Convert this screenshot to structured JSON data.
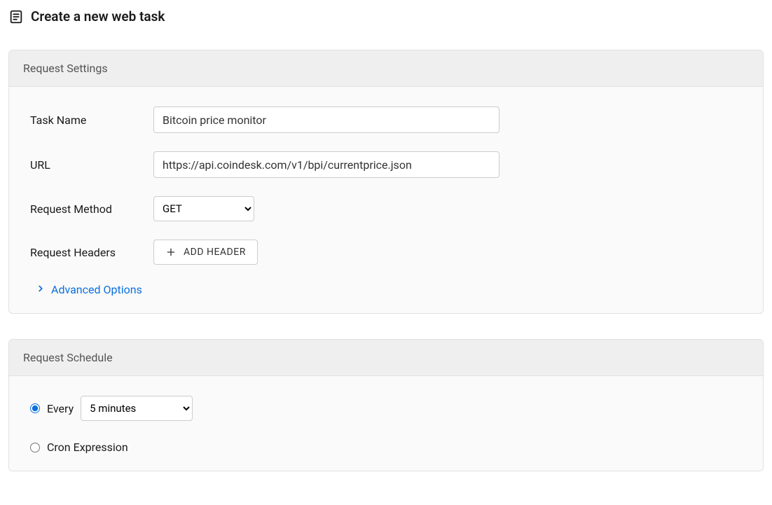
{
  "header": {
    "title": "Create a new web task"
  },
  "settings": {
    "card_title": "Request Settings",
    "task_name_label": "Task Name",
    "task_name_value": "Bitcoin price monitor",
    "url_label": "URL",
    "url_value": "https://api.coindesk.com/v1/bpi/currentprice.json",
    "method_label": "Request Method",
    "method_value": "GET",
    "headers_label": "Request Headers",
    "add_header_button": "ADD HEADER",
    "advanced_link": "Advanced Options"
  },
  "schedule": {
    "card_title": "Request Schedule",
    "every_label": "Every",
    "every_checked": true,
    "interval_value": "5 minutes",
    "cron_label": "Cron Expression",
    "cron_checked": false
  }
}
